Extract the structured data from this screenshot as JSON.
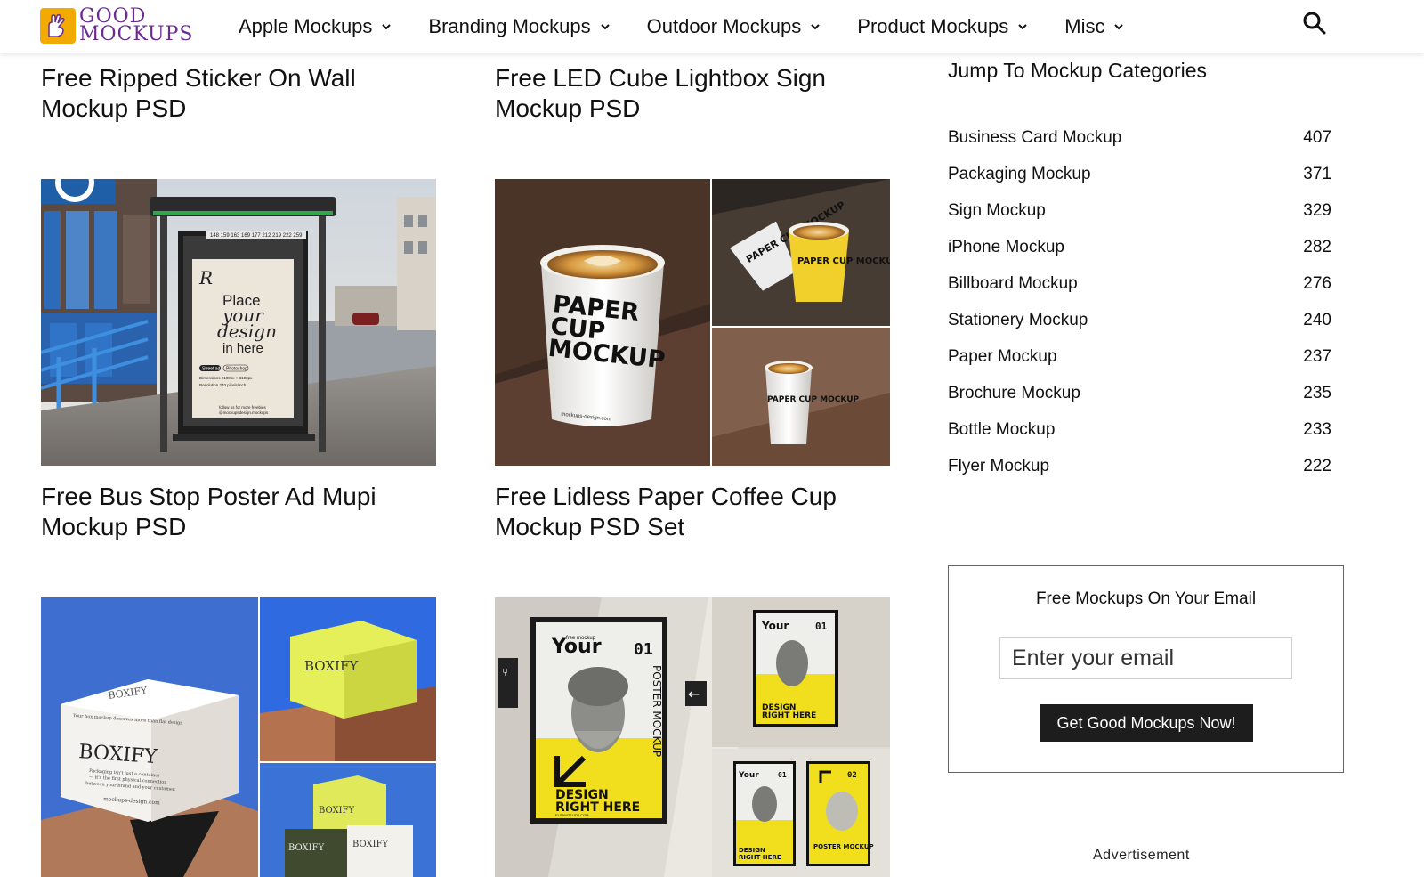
{
  "header": {
    "logo": {
      "line1": "GOOD",
      "line2": "MOCKUPS"
    },
    "nav": [
      {
        "label": "Apple Mockups"
      },
      {
        "label": "Branding Mockups"
      },
      {
        "label": "Outdoor Mockups"
      },
      {
        "label": "Product Mockups"
      },
      {
        "label": "Misc"
      }
    ]
  },
  "posts": [
    {
      "title": "Free Ripped Sticker On Wall Mockup PSD"
    },
    {
      "title": "Free LED Cube Lightbox Sign Mockup PSD"
    },
    {
      "title": "Free Bus Stop Poster Ad Mupi Mockup PSD"
    },
    {
      "title": "Free Lidless Paper Coffee Cup Mockup PSD Set"
    }
  ],
  "thumbs": {
    "bus_stop": {
      "poster_brand": "R",
      "poster_line1": "Place",
      "poster_line2": "your",
      "poster_line3": "design",
      "poster_line4": "in here",
      "chip1": "Street ad",
      "chip2": "Photoshop",
      "spec1": "Dimensions 2100px × 3100px",
      "spec2": "Resolution 240 pixels/inch",
      "follow": "follow us for more freebies",
      "follow_handle": "@mockupsdesign.mockups",
      "ticker": "148 159 163 169 177 212 219 222 259"
    },
    "cup": {
      "main_label": "PAPER CUP MOCKUP",
      "main_l1": "PAPER",
      "main_l2": "CUP",
      "main_l3": "MOCKUP",
      "url": "mockups-design.com"
    },
    "box": {
      "brand": "BOXIFY",
      "tagline": "Your box mockup deserves more than flat design",
      "sub1": "Packaging isn't just a container",
      "sub2": "— it's the first physical connection",
      "sub3": "between your brand and your customer.",
      "url": "mockups-design.com"
    },
    "poster": {
      "your": "Your",
      "free": "free mockup",
      "num1": "01",
      "num2": "02",
      "vertical": "POSTER MOCKUP",
      "line1": "DESIGN",
      "line2": "RIGHT HERE",
      "small_url": "ELSAWTFUTR.COM",
      "poster2": "POSTER MOCKUP"
    }
  },
  "sidebar": {
    "title": "Jump To Mockup Categories",
    "categories": [
      {
        "name": "Business Card Mockup",
        "count": "407"
      },
      {
        "name": "Packaging Mockup",
        "count": "371"
      },
      {
        "name": "Sign Mockup",
        "count": "329"
      },
      {
        "name": "iPhone Mockup",
        "count": "282"
      },
      {
        "name": "Billboard Mockup",
        "count": "276"
      },
      {
        "name": "Stationery Mockup",
        "count": "240"
      },
      {
        "name": "Paper Mockup",
        "count": "237"
      },
      {
        "name": "Brochure Mockup",
        "count": "235"
      },
      {
        "name": "Bottle Mockup",
        "count": "233"
      },
      {
        "name": "Flyer Mockup",
        "count": "222"
      }
    ],
    "newsletter": {
      "title": "Free Mockups On Your Email",
      "placeholder": "Enter your email",
      "button": "Get Good Mockups Now!"
    },
    "ad_label": "Advertisement"
  },
  "colors": {
    "brand_purple": "#6b2c91",
    "brand_yellow": "#f2a900",
    "button_dark": "#1d1d1d",
    "newsletter_border": "#8a3fb3"
  }
}
